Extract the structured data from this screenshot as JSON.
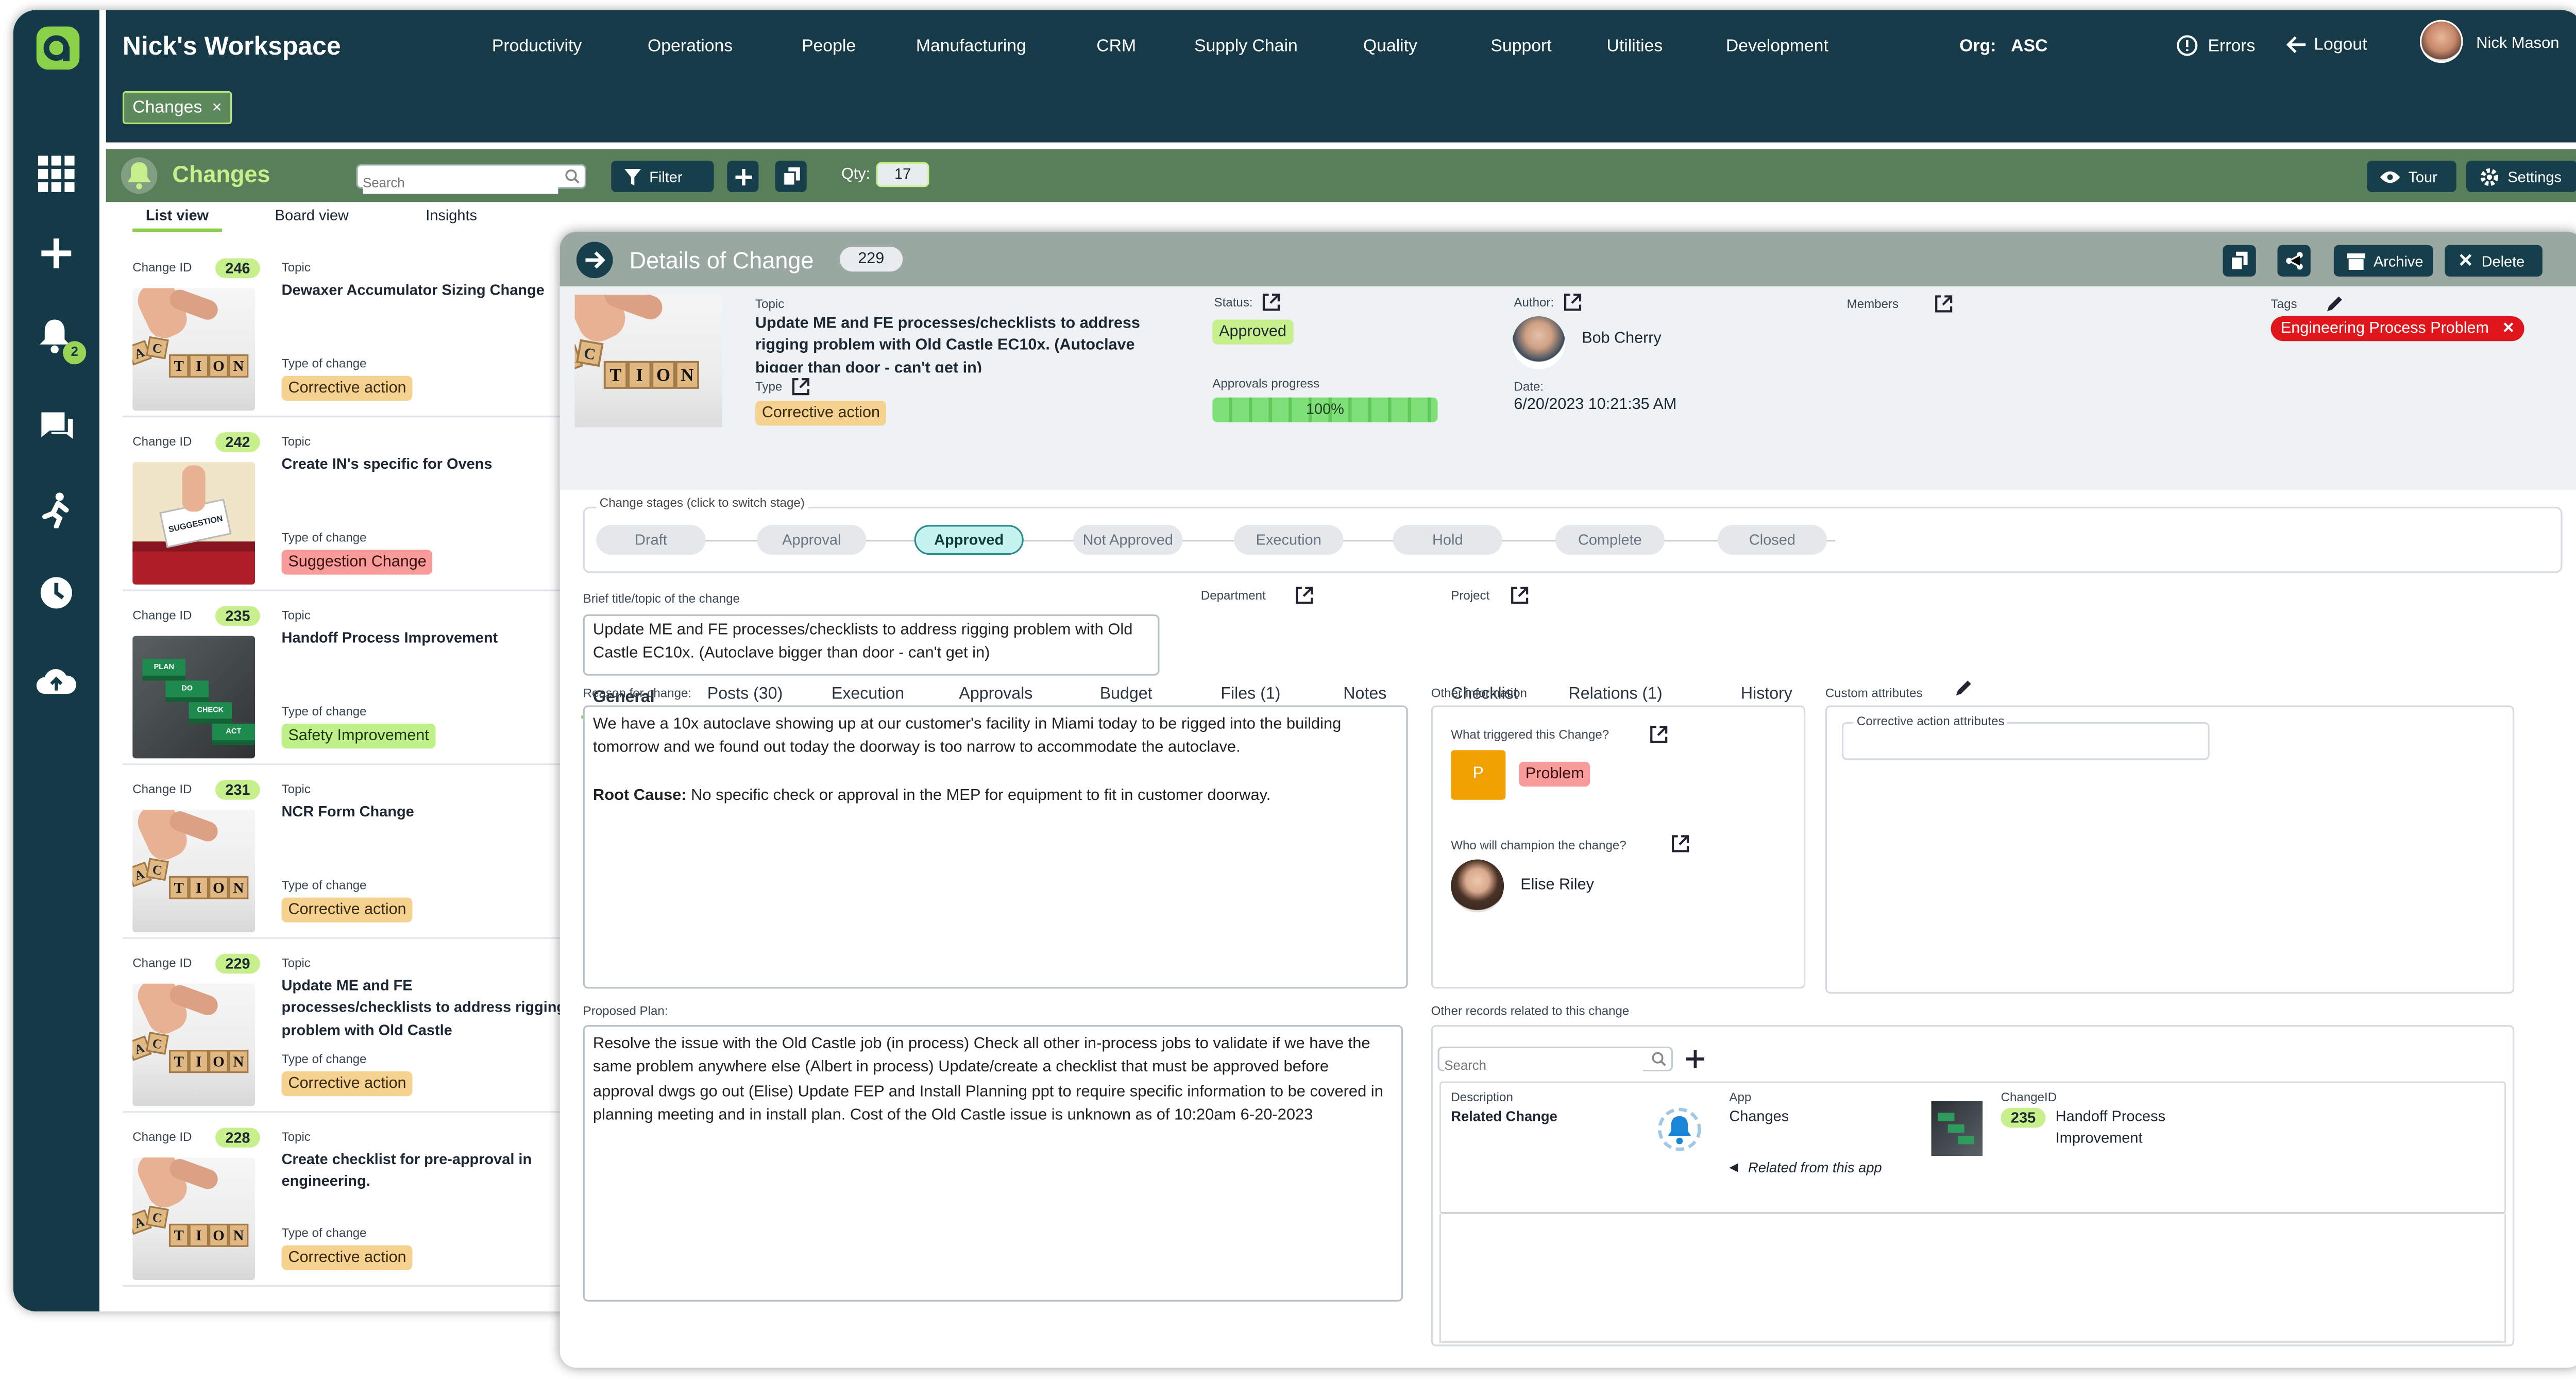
{
  "workspace": {
    "title": "Nick's Workspace",
    "org_label": "Org:",
    "org_value": "ASC",
    "errors": "Errors",
    "logout": "Logout",
    "user": "Nick Mason"
  },
  "nav": [
    "Productivity",
    "Operations",
    "People",
    "Manufacturing",
    "CRM",
    "Supply Chain",
    "Quality",
    "Support",
    "Utilities",
    "Development"
  ],
  "open_tab": {
    "label": "Changes",
    "close": "×"
  },
  "toolbar": {
    "title": "Changes",
    "search_placeholder": "Search",
    "filter": "Filter",
    "qty_label": "Qty:",
    "qty_value": "17",
    "tour": "Tour",
    "settings": "Settings"
  },
  "rail": {
    "notification_count": "2"
  },
  "views": [
    "List view",
    "Board view",
    "Insights"
  ],
  "list": {
    "id_label": "Change ID",
    "topic_label": "Topic",
    "type_label": "Type of change",
    "items": [
      {
        "id": "246",
        "topic": "Dewaxer Accumulator Sizing Change",
        "type": "Corrective action"
      },
      {
        "id": "242",
        "topic": "Create IN's specific for Ovens",
        "type": "Suggestion Change"
      },
      {
        "id": "235",
        "topic": "Handoff Process Improvement",
        "type": "Safety Improvement"
      },
      {
        "id": "231",
        "topic": "NCR Form Change",
        "type": "Corrective action"
      },
      {
        "id": "229",
        "topic": "Update ME and FE processes/checklists to address rigging problem with Old Castle",
        "type": "Corrective action"
      },
      {
        "id": "228",
        "topic": "Create checklist for pre-approval in engineering.",
        "type": "Corrective action"
      }
    ]
  },
  "thumb_texts": {
    "action": "ACTION",
    "suggestion": "SUGGESTION",
    "plan": "PLAN",
    "do": "DO",
    "check": "CHECK",
    "act": "ACT"
  },
  "detail": {
    "title": "Details of Change",
    "id": "229",
    "archive": "Archive",
    "delete": "Delete",
    "topic_label": "Topic",
    "topic": "Update ME and FE processes/checklists to address rigging problem with Old Castle EC10x.  (Autoclave bigger than door - can't get in)",
    "type_label": "Type",
    "type": "Corrective action",
    "status_label": "Status:",
    "status": "Approved",
    "progress_label": "Approvals progress",
    "progress": "100%",
    "progress_value": 1.0,
    "author_label": "Author:",
    "author": "Bob Cherry",
    "date_label": "Date:",
    "date": "6/20/2023 10:21:35 AM",
    "members_label": "Members",
    "tags_label": "Tags",
    "tag": "Engineering Process Problem"
  },
  "tabs": [
    "General",
    "Posts (30)",
    "Execution",
    "Approvals",
    "Budget",
    "Files (1)",
    "Notes",
    "Checklist",
    "Relations (1)",
    "History"
  ],
  "stages": {
    "label": "Change stages (click to switch stage)",
    "items": [
      "Draft",
      "Approval",
      "Approved",
      "Not Approved",
      "Execution",
      "Hold",
      "Complete",
      "Closed"
    ],
    "active": "Approved"
  },
  "form": {
    "brief_label": "Brief title/topic of the change",
    "brief": "Update ME and FE processes/checklists to address rigging problem with Old Castle EC10x.  (Autoclave bigger than door - can't get in)",
    "department_label": "Department",
    "project_label": "Project",
    "reason_label": "Reason for change:",
    "reason": "We have a 10x autoclave showing up at our customer's facility in Miami today to be rigged into the building tomorrow and we found out today the doorway is too narrow to accommodate the autoclave.",
    "root_label": "Root Cause:",
    "root": " No specific check or approval in the MEP for equipment to fit in customer doorway.",
    "plan_label": "Proposed Plan:",
    "plan": "Resolve the issue with the Old Castle job (in process) Check all other in-process jobs to validate if we have the same problem anywhere else (Albert in process) Update/create a checklist that must be approved before approval dwgs go out (Elise) Update FEP and Install Planning ppt to require specific information to be covered in planning meeting and in install plan. Cost of the Old Castle issue is unknown as of 10:20am 6-20-2023"
  },
  "other": {
    "label": "Other information",
    "trigger_label": "What triggered this Change?",
    "trigger_letter": "P",
    "trigger": "Problem",
    "champion_label": "Who will champion the change?",
    "champion": "Elise Riley"
  },
  "custom": {
    "label": "Custom attributes",
    "group": "Corrective action attributes"
  },
  "related": {
    "label": "Other records related to this change",
    "search_placeholder": "Search",
    "desc_label": "Description",
    "desc": "Related Change",
    "app_label": "App",
    "app": "Changes",
    "id_label": "ChangeID",
    "id": "235",
    "name": "Handoff Process Improvement",
    "note": "Related from this app"
  },
  "colors": {
    "rail": "#143a47",
    "topbar": "#163a48",
    "toolbar": "#587e5a",
    "accent": "#c7f08c",
    "tag_red": "#e0161d",
    "stage_active": "#c6f2f0"
  }
}
